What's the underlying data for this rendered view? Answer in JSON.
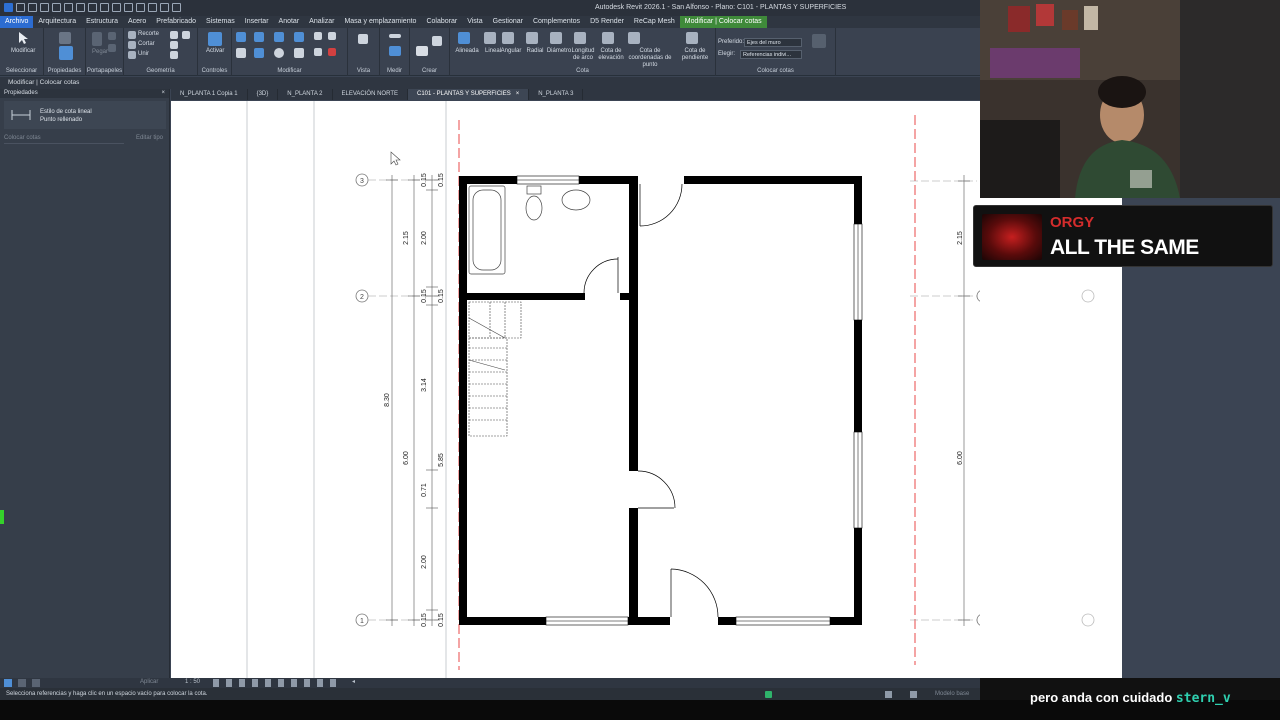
{
  "app": {
    "title": "Autodesk Revit 2026.1 - San Alfonso - Plano: C101 - PLANTAS Y SUPERFICIES"
  },
  "menu": {
    "items": [
      "Archivo",
      "Arquitectura",
      "Estructura",
      "Acero",
      "Prefabricado",
      "Sistemas",
      "Insertar",
      "Anotar",
      "Analizar",
      "Masa y emplazamiento",
      "Colaborar",
      "Vista",
      "Gestionar",
      "Complementos",
      "D5 Render",
      "ReCap Mesh",
      "Modificar | Colocar cotas"
    ]
  },
  "ribbon": {
    "modify_label": "Modificar",
    "recorte": "Recorte",
    "cortar": "Cortar",
    "unir": "Unir",
    "pegar": "Pegar",
    "activar": "Activar",
    "groups": {
      "seleccionar": "Seleccionar",
      "propiedades": "Propiedades",
      "portapapeles": "Portapapeles",
      "geometria": "Geometría",
      "controles": "Controles",
      "modificar": "Modificar",
      "vista": "Vista",
      "medir": "Medir",
      "crear": "Crear",
      "cota": "Cota",
      "colocar_cotas": "Colocar cotas"
    },
    "cota_tools": [
      "Alineada",
      "Lineal",
      "Angular",
      "Radial",
      "Diámetro",
      "Longitud de arco",
      "Cota de elevación",
      "Cota de coordenadas de punto",
      "Cota de pendiente"
    ],
    "preferido_label": "Preferido:",
    "preferido_value": "Ejes del muro",
    "elegir_label": "Elegir:",
    "elegir_value": "Referencias indivi..."
  },
  "context": {
    "label": "Modificar | Colocar cotas"
  },
  "properties": {
    "header": "Propiedades",
    "type_line1": "Estilo de cota lineal",
    "type_line2": "Punto rellenado",
    "filter": "Colocar cotas",
    "edit_type": "Editar tipo"
  },
  "tabs": [
    {
      "label": "N_PLANTA 1 Copia 1",
      "active": false
    },
    {
      "label": "{3D}",
      "active": false
    },
    {
      "label": "N_PLANTA 2",
      "active": false
    },
    {
      "label": "ELEVACIÓN NORTE",
      "active": false
    },
    {
      "label": "C101 - PLANTAS Y SUPERFICIES",
      "active": true
    },
    {
      "label": "N_PLANTA 3",
      "active": false
    }
  ],
  "drawing": {
    "grid_labels": [
      "3",
      "2",
      "1"
    ],
    "dims_left": [
      "2.15",
      "8.30",
      "6.00"
    ],
    "dims_mid": [
      "0.15",
      "2.00",
      "0.15",
      "3.14",
      "5.85",
      "0.71",
      "2.00",
      "0.15"
    ],
    "dims_right": [
      "2.15",
      "6.00"
    ]
  },
  "viewbar": {
    "scale": "1 : 50",
    "apply": "Aplicar"
  },
  "status": {
    "message": "Selecciona referencias y haga clic en un espacio vacío para colocar la cota.",
    "model": "Modelo base"
  },
  "overlay": {
    "artist": "ORGY",
    "song": "ALL THE SAME"
  },
  "subtitle": {
    "text": "pero anda con cuidado",
    "user": "stern_v"
  },
  "colors": {
    "accent": "#2c6cd1",
    "context_tab": "#3f8a3a",
    "wall": "#000000",
    "grid_line": "#e8484a"
  }
}
